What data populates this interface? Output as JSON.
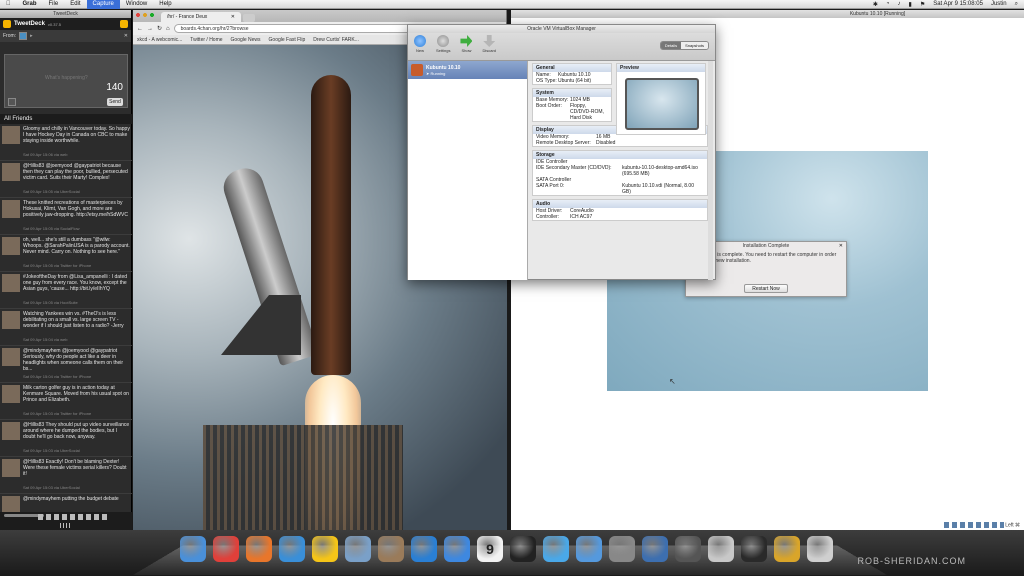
{
  "menubar": {
    "apple": "",
    "items": [
      "Grab",
      "File",
      "Edit",
      "Capture",
      "Window",
      "Help"
    ],
    "active_item": "Capture",
    "clock": "Sat Apr 9  15:08:05",
    "user": "Justin"
  },
  "tweetdeck": {
    "window_title": "TweetDeck",
    "app_name": "TweetDeck",
    "version": "v0.37.5",
    "from_label": "From:",
    "compose_placeholder": "What's happening?",
    "char_count": "140",
    "send_label": "Send",
    "column_title": "All Friends",
    "tweets": [
      {
        "text": "Gloomy and chilly in Vancouver today. So happy I have Hockey Day in Canada on CBC to make staying inside worthwhile.",
        "meta": "Sat 09 Apr 15:06 via web"
      },
      {
        "text": "@Hillis83 @joemyood @gaypatriot because then they can play the poor, bullied, persecuted victim card. Suits their Marty! Complex!",
        "meta": "Sat 09 Apr 15:05 via UberSocial"
      },
      {
        "text": "These knitted recreations of masterpieces by Hokusai, Klimt, Van Gogh, and more are positively jaw-dropping. http://etsy.me/hSdWVC",
        "meta": "Sat 09 Apr 15:05 via SocialFlow"
      },
      {
        "text": "oh, well... she's still a dumbass \"@wilw: Whoops. @SarahPalinUSA is a parody account. Never mind. Carry on. Nothing to see here.\"",
        "meta": "Sat 09 Apr 15:05 via Twitter for iPhone"
      },
      {
        "text": "#JokeoftheDay from @Lisa_ampanelli : I dated one guy from every race. You know, except the Asian guys, 'cause... http://bit.ly/eIIhYQ",
        "meta": "Sat 09 Apr 15:05 via HootSuite"
      },
      {
        "text": "Watching Yankees win vs. #TheO's is less debilitating on a small vs. large screen TV - wonder if I should just listen to a radio? -Jerry",
        "meta": "Sat 09 Apr 15:04 via web"
      },
      {
        "text": "@mindymayhem @joemyood @gaypatriot Seriously, why do people act like a deer in headlights when someone calls them on their bs...",
        "meta": "Sat 09 Apr 15:04 via Twitter for iPhone"
      },
      {
        "text": "Milk carton golfer guy is in action today at Kenmare Square. Moved from his usual spot on Prince and Elizabeth.",
        "meta": "Sat 09 Apr 15:03 via Twitter for iPhone"
      },
      {
        "text": "@Hillis83 They should put up video surveillance around where he dumped the bodies, but I doubt he'll go back now, anyway.",
        "meta": "Sat 09 Apr 15:03 via UberSocial"
      },
      {
        "text": "@Hillis83 Exactly! Don't be blaming Dexter! Were these female victims serial killers? Doubt it!",
        "meta": "Sat 09 Apr 15:03 via UberSocial"
      },
      {
        "text": "@mindymayhem putting the budget debate",
        "meta": ""
      }
    ]
  },
  "browser": {
    "tab_label": "/hr/ - France Deux",
    "url": "boards.4chan.org/hr/2?browse",
    "bookmarks": [
      "xkcd - A webcomic...",
      "Twitter / Home",
      "Google News",
      "Google Fast Flip",
      "Drew Curtis' FARK..."
    ]
  },
  "vm_window": {
    "title": "Kubuntu 10.10 [Running]",
    "dialog_title": "Installation Complete",
    "dialog_message": "Installation is complete. You need to restart the computer in order to use the new installation.",
    "restart_label": "Restart Now",
    "status_text": "Left ⌘"
  },
  "vbox": {
    "title": "Oracle VM VirtualBox Manager",
    "toolbar": [
      {
        "label": "New",
        "icon": "new-icon",
        "color": "#2d7fd8"
      },
      {
        "label": "Settings",
        "icon": "gear-icon",
        "color": "#9a9a9a"
      },
      {
        "label": "Show",
        "icon": "show-arrow-icon",
        "color": "#3fae3f"
      },
      {
        "label": "Discard",
        "icon": "discard-icon",
        "color": "#b5b5b5"
      }
    ],
    "seg_details": "Details",
    "seg_snapshots": "Snapshots",
    "vm_name": "Kubuntu 10.10",
    "vm_state": "Running",
    "general": {
      "header": "General",
      "name_k": "Name:",
      "name_v": "Kubuntu 10.10",
      "os_k": "OS Type:",
      "os_v": "Ubuntu (64 bit)"
    },
    "preview_header": "Preview",
    "system": {
      "header": "System",
      "mem_k": "Base Memory:",
      "mem_v": "1024 MB",
      "boot_k": "Boot Order:",
      "boot_v": "Floppy, CD/DVD-ROM, Hard Disk"
    },
    "display": {
      "header": "Display",
      "vmem_k": "Video Memory:",
      "vmem_v": "16 MB",
      "rds_k": "Remote Desktop Server:",
      "rds_v": "Disabled"
    },
    "storage": {
      "header": "Storage",
      "ide": "IDE Controller",
      "ide_k": "IDE Secondary Master (CD/DVD):",
      "ide_v": "kubuntu-10.10-desktop-amd64.iso (695.58 MB)",
      "sata": "SATA Controller",
      "sata_k": "SATA Port 0:",
      "sata_v": "Kubuntu 10.10.vdi (Normal, 8.00 GB)"
    },
    "audio": {
      "header": "Audio",
      "host_k": "Host Driver:",
      "host_v": "CoreAudio",
      "ctrl_k": "Controller:",
      "ctrl_v": "ICH AC97"
    }
  },
  "dock": {
    "watermark": "ROB-SHERIDAN.COM",
    "apps": [
      {
        "name": "finder-icon",
        "color": "#4a90d9"
      },
      {
        "name": "chrome-icon",
        "color": "#e0403a"
      },
      {
        "name": "firefox-icon",
        "color": "#e8762b"
      },
      {
        "name": "safari-icon",
        "color": "#3a8fd8"
      },
      {
        "name": "tweetdeck-dock-icon",
        "color": "#f5c518"
      },
      {
        "name": "mail-stamp-icon",
        "color": "#7aa0c8"
      },
      {
        "name": "iphoto-icon",
        "color": "#9a7b5a"
      },
      {
        "name": "itunes-icon",
        "color": "#2a7fd4"
      },
      {
        "name": "appstore-icon",
        "color": "#3e88e0"
      },
      {
        "name": "ical-icon",
        "color": "#f2f2f2"
      },
      {
        "name": "terminal-icon",
        "color": "#222222"
      },
      {
        "name": "ichat-icon",
        "color": "#4aa8e8"
      },
      {
        "name": "quicktime-icon",
        "color": "#5599dd"
      },
      {
        "name": "preferences-icon",
        "color": "#888888"
      },
      {
        "name": "virtualbox-icon",
        "color": "#3d6fb0"
      },
      {
        "name": "display-icon",
        "color": "#555555"
      },
      {
        "name": "script-editor-icon",
        "color": "#c8c8c8"
      },
      {
        "name": "activity-monitor-icon",
        "color": "#2a2a2a"
      },
      {
        "name": "notes-icon",
        "color": "#d9a52a"
      },
      {
        "name": "trash-icon",
        "color": "#cfcfcf"
      }
    ],
    "calendar_day": "9"
  }
}
